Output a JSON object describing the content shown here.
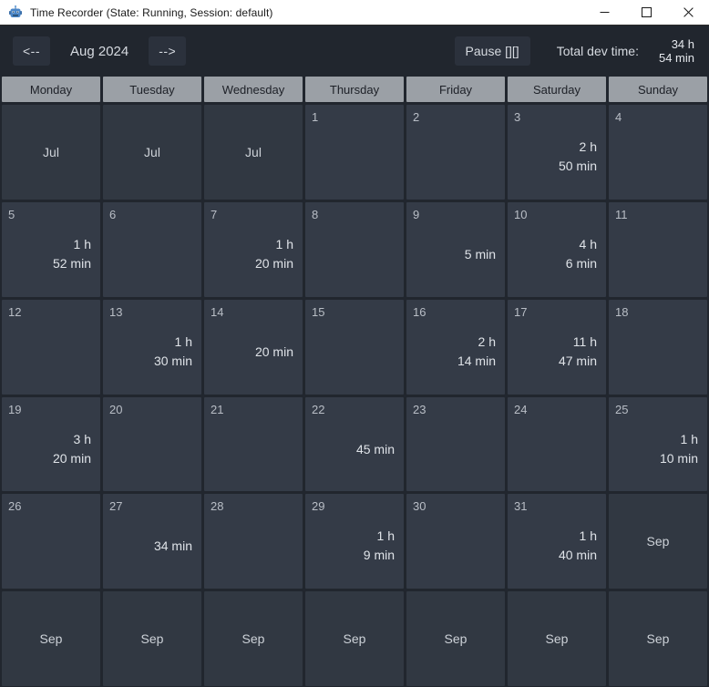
{
  "window": {
    "title": "Time Recorder (State: Running, Session: default)",
    "icon": "robot-icon",
    "controls": {
      "minimize": "minimize-icon",
      "maximize": "maximize-icon",
      "close": "close-icon"
    }
  },
  "toolbar": {
    "prev_label": "<--",
    "month_label": "Aug 2024",
    "next_label": "-->",
    "pause_label": "Pause [][]",
    "total_label": "Total dev time:",
    "total_hours": "34 h",
    "total_minutes": "54 min"
  },
  "calendar": {
    "day_headers": [
      "Monday",
      "Tuesday",
      "Wednesday",
      "Thursday",
      "Friday",
      "Saturday",
      "Sunday"
    ],
    "weeks": [
      [
        {
          "other_month": "Jul"
        },
        {
          "other_month": "Jul"
        },
        {
          "other_month": "Jul"
        },
        {
          "day": "1"
        },
        {
          "day": "2"
        },
        {
          "day": "3",
          "hours": "2 h",
          "minutes": "50 min"
        },
        {
          "day": "4"
        }
      ],
      [
        {
          "day": "5",
          "hours": "1 h",
          "minutes": "52 min"
        },
        {
          "day": "6"
        },
        {
          "day": "7",
          "hours": "1 h",
          "minutes": "20 min"
        },
        {
          "day": "8"
        },
        {
          "day": "9",
          "minutes": "5 min"
        },
        {
          "day": "10",
          "hours": "4 h",
          "minutes": "6 min"
        },
        {
          "day": "11"
        }
      ],
      [
        {
          "day": "12"
        },
        {
          "day": "13",
          "hours": "1 h",
          "minutes": "30 min"
        },
        {
          "day": "14",
          "minutes": "20 min"
        },
        {
          "day": "15"
        },
        {
          "day": "16",
          "hours": "2 h",
          "minutes": "14 min"
        },
        {
          "day": "17",
          "hours": "11 h",
          "minutes": "47 min"
        },
        {
          "day": "18"
        }
      ],
      [
        {
          "day": "19",
          "hours": "3 h",
          "minutes": "20 min"
        },
        {
          "day": "20"
        },
        {
          "day": "21"
        },
        {
          "day": "22",
          "minutes": "45 min"
        },
        {
          "day": "23"
        },
        {
          "day": "24"
        },
        {
          "day": "25",
          "hours": "1 h",
          "minutes": "10 min"
        }
      ],
      [
        {
          "day": "26"
        },
        {
          "day": "27",
          "minutes": "34 min"
        },
        {
          "day": "28"
        },
        {
          "day": "29",
          "hours": "1 h",
          "minutes": "9 min"
        },
        {
          "day": "30"
        },
        {
          "day": "31",
          "hours": "1 h",
          "minutes": "40 min"
        },
        {
          "other_month": "Sep"
        }
      ],
      [
        {
          "other_month": "Sep"
        },
        {
          "other_month": "Sep"
        },
        {
          "other_month": "Sep"
        },
        {
          "other_month": "Sep"
        },
        {
          "other_month": "Sep"
        },
        {
          "other_month": "Sep"
        },
        {
          "other_month": "Sep"
        }
      ]
    ]
  },
  "colors": {
    "window_bg": "#21262e",
    "cell_bg": "#343b47",
    "cell_out_bg": "#313842",
    "header_bg": "#9ba0a6",
    "button_bg": "#2b313c",
    "text": "#d6dae0",
    "titlebar_bg": "#ffffff"
  }
}
